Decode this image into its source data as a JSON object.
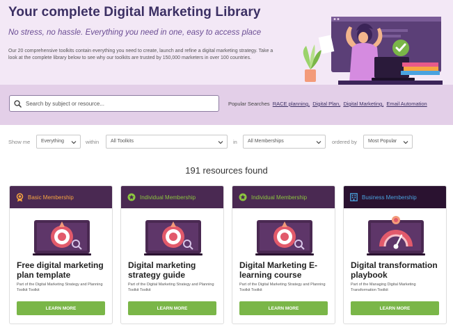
{
  "hero": {
    "title": "Your complete Digital Marketing Library",
    "tagline": "No stress, no hassle. Everything you need in one, easy to access place",
    "body": "Our 20 comprehensive toolkits contain everything you need to create, launch and refine a digital marketing strategy. Take a look at the complete library below to see why our toolkits are trusted by 150,000 marketers in over 100 countries."
  },
  "search": {
    "placeholder": "Search by subject or resource...",
    "popular_label": "Popular Searches",
    "popular": [
      "RACE planning,",
      "Digital Plan,",
      "Digital Marketing,",
      "Email Automation"
    ]
  },
  "filters": {
    "show_me_label": "Show me",
    "show_me_value": "Everything",
    "within_label": "within",
    "within_value": "All Toolkits",
    "in_label": "in",
    "in_value": "All Memberships",
    "ordered_label": "ordered by",
    "ordered_value": "Most Popular"
  },
  "results": {
    "count_text": "191 resources found"
  },
  "cards": [
    {
      "membership": "Basic Membership",
      "membership_color": "#f7a541",
      "header_bg": "#4a2952",
      "icon": "medal-icon",
      "title": "Free digital marketing plan template",
      "subtitle": "Part of the Digital Marketing Strategy and Planning Toolkit Toolkit",
      "button": "LEARN MORE"
    },
    {
      "membership": "Individual Membership",
      "membership_color": "#8cc63f",
      "header_bg": "#4a2952",
      "icon": "star-badge-icon",
      "title": "Digital marketing strategy guide",
      "subtitle": "Part of the Digital Marketing Strategy and Planning Toolkit Toolkit",
      "button": "LEARN MORE"
    },
    {
      "membership": "Individual Membership",
      "membership_color": "#8cc63f",
      "header_bg": "#4a2952",
      "icon": "star-badge-icon",
      "title": "Digital Marketing E-learning course",
      "subtitle": "Part of the Digital Marketing Strategy and Planning Toolkit Toolkit",
      "button": "LEARN MORE"
    },
    {
      "membership": "Business Membership",
      "membership_color": "#4aa3df",
      "header_bg": "#2a1230",
      "icon": "building-icon",
      "title": "Digital transformation playbook",
      "subtitle": "Part of the Managing Digital Marketing Transformation Toolkit",
      "button": "LEARN MORE"
    }
  ],
  "colors": {
    "hero_bg": "#f3e8f6",
    "search_band_bg": "#e3cfe8",
    "title": "#3b2f63",
    "button_green": "#7ab648"
  }
}
